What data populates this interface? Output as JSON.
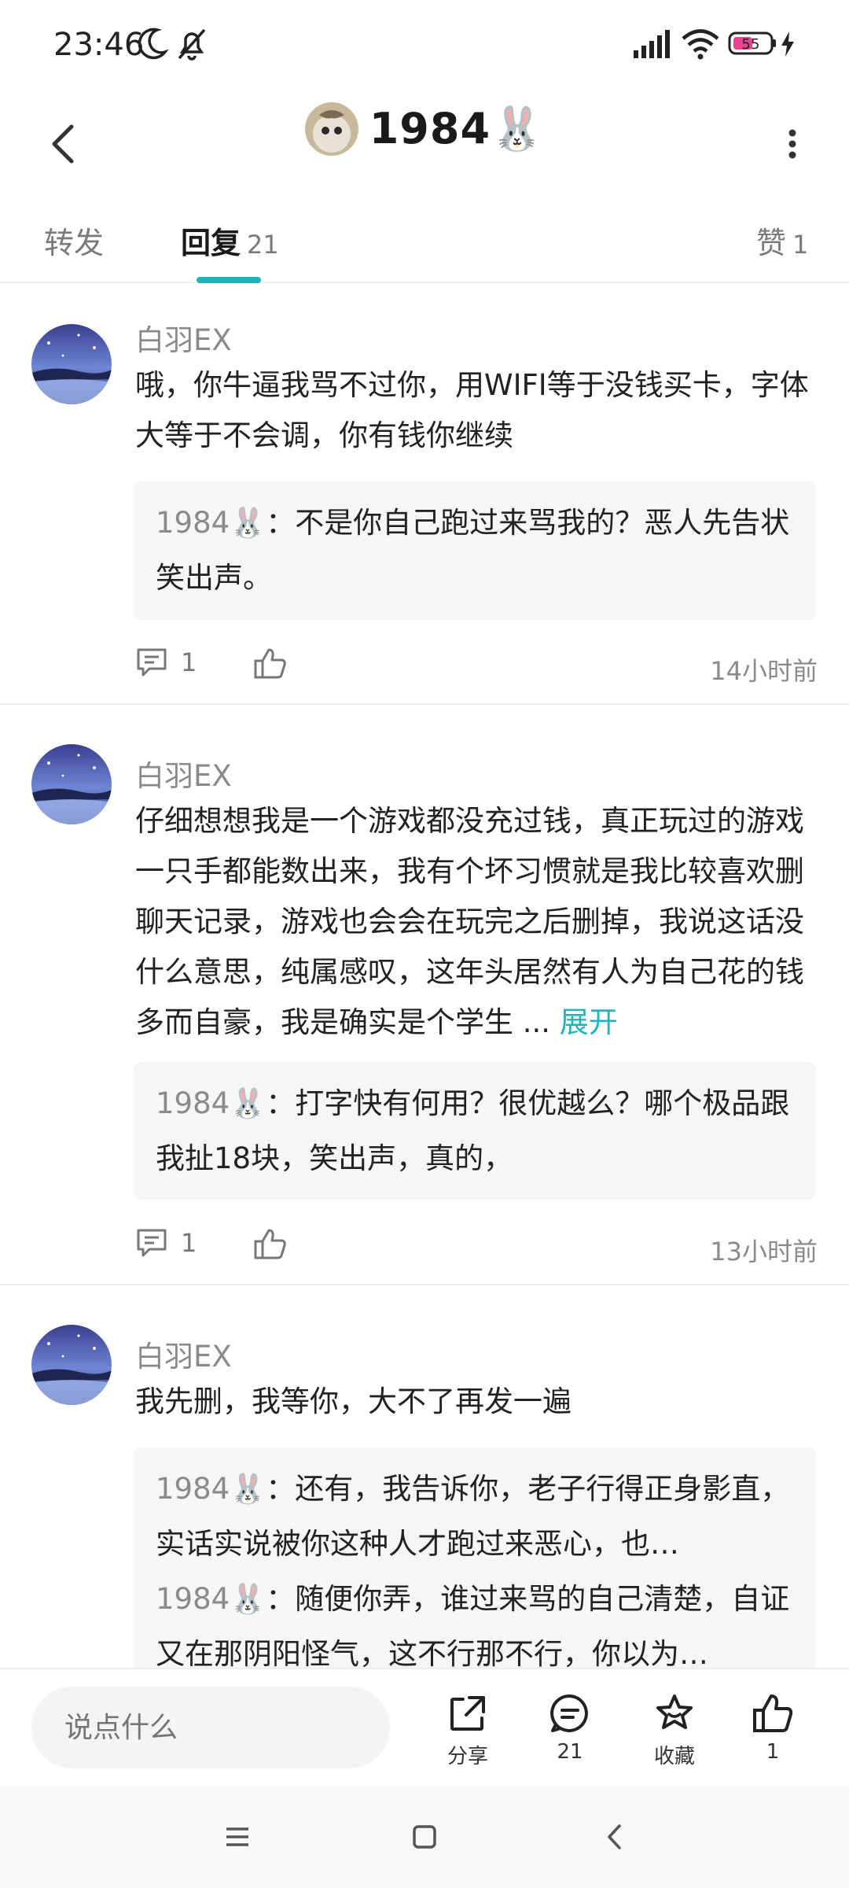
{
  "status_bar": {
    "time": "23:46",
    "battery": "55",
    "icons": [
      "moon-icon",
      "bell-off-icon",
      "signal-icon",
      "wifi-icon",
      "battery-icon",
      "charging-icon"
    ]
  },
  "header": {
    "title": "1984🐰",
    "back_icon": "chevron-left-icon",
    "more_icon": "more-vertical-icon"
  },
  "tabs": [
    {
      "label": "转发",
      "count": ""
    },
    {
      "label": "回复",
      "count": "21"
    },
    {
      "label": "赞",
      "count": "1"
    }
  ],
  "accent_color": "#1fb3ba",
  "comments": [
    {
      "author": "白羽EX",
      "text": "哦，你牛逼我骂不过你，用WIFI等于没钱买卡，字体大等于不会调，你有钱你继续",
      "replies": [
        {
          "user": "1984🐰",
          "text": "：不是你自己跑过来骂我的？恶人先告状笑出声。"
        }
      ],
      "reply_count": "1",
      "time": "14小时前"
    },
    {
      "author": "白羽EX",
      "text": "仔细想想我是一个游戏都没充过钱，真正玩过的游戏一只手都能数出来，我有个坏习惯就是我比较喜欢删聊天记录，游戏也会会在玩完之后删掉，我说这话没什么意思，纯属感叹，这年头居然有人为自己花的钱多而自豪，我是确实是个学生 ...",
      "expand_label": "展开",
      "replies": [
        {
          "user": "1984🐰",
          "text": "：打字快有何用？很优越么？哪个极品跟我扯18块，笑出声，真的，"
        }
      ],
      "reply_count": "1",
      "time": "13小时前"
    },
    {
      "author": "白羽EX",
      "text": "我先删，我等你，大不了再发一遍",
      "replies": [
        {
          "user": "1984🐰",
          "text": "：还有，我告诉你，老子行得正身影直，实话实说被你这种人才跑过来恶心，也…"
        },
        {
          "user": "1984🐰",
          "text": "：随便你弄，谁过来骂的自己清楚，自证又在那阴阳怪气，这不行那不行，你以为…"
        }
      ]
    }
  ],
  "bottom_bar": {
    "input_placeholder": "说点什么",
    "share_label": "分享",
    "comment_count": "21",
    "favorite_label": "收藏",
    "like_count": "1"
  }
}
